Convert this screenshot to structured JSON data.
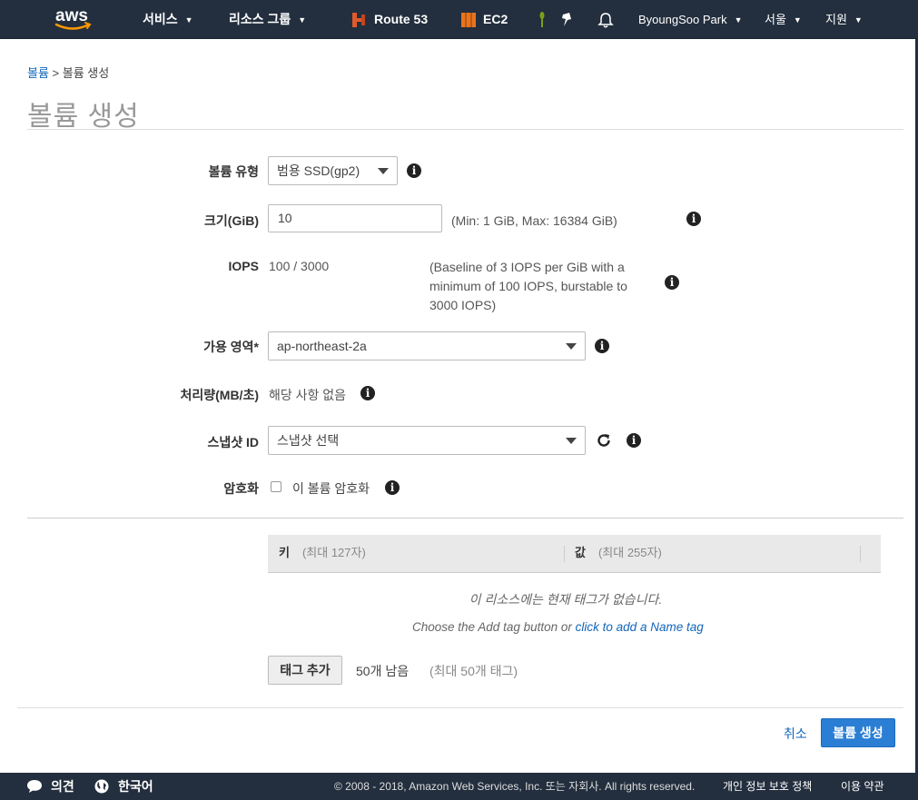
{
  "nav": {
    "services": "서비스",
    "resource_groups": "리소스 그룹",
    "route53": "Route 53",
    "ec2": "EC2",
    "user": "ByoungSoo Park",
    "region": "서울",
    "support": "지원",
    "colors": {
      "bar": "#232f3e",
      "route53": "#e05a2b",
      "ec2": "#e8741e",
      "plant": "#7aa116"
    }
  },
  "breadcrumb": {
    "parent": "볼륨",
    "separator": ">",
    "current": "볼륨 생성"
  },
  "title": "볼륨 생성",
  "form": {
    "volume_type": {
      "label": "볼륨 유형",
      "value": "범용 SSD(gp2)"
    },
    "size": {
      "label": "크기(GiB)",
      "value": "10",
      "hint": "(Min: 1 GiB, Max: 16384 GiB)"
    },
    "iops": {
      "label": "IOPS",
      "value": "100 / 3000",
      "hint_lines": [
        "(Baseline of 3 IOPS per GiB with a",
        "minimum of 100 IOPS, burstable to",
        "3000 IOPS)"
      ]
    },
    "az": {
      "label": "가용 영역*",
      "value": "ap-northeast-2a"
    },
    "throughput": {
      "label": "처리량(MB/초)",
      "value": "해당 사항 없음"
    },
    "snapshot": {
      "label": "스냅샷 ID",
      "placeholder": "스냅샷 선택"
    },
    "encryption": {
      "label": "암호화",
      "checkbox_label": "이 볼륨 암호화",
      "checked": false
    }
  },
  "tags": {
    "key_header": "키",
    "key_hint": "(최대 127자)",
    "value_header": "값",
    "value_hint": "(최대 255자)",
    "empty_message": "이 리소스에는 현재 태그가 없습니다.",
    "choose_text": "Choose the Add tag button or",
    "add_name_link": "click to add a Name tag",
    "add_button": "태그 추가",
    "remaining": "50개 남음",
    "max_note": "(최대 50개 태그)"
  },
  "actions": {
    "cancel": "취소",
    "create": "볼륨 생성"
  },
  "footer": {
    "feedback": "의견",
    "language": "한국어",
    "copyright": "© 2008 - 2018, Amazon Web Services, Inc. 또는 자회사. All rights reserved.",
    "privacy": "개인 정보 보호 정책",
    "terms": "이용 약관"
  }
}
